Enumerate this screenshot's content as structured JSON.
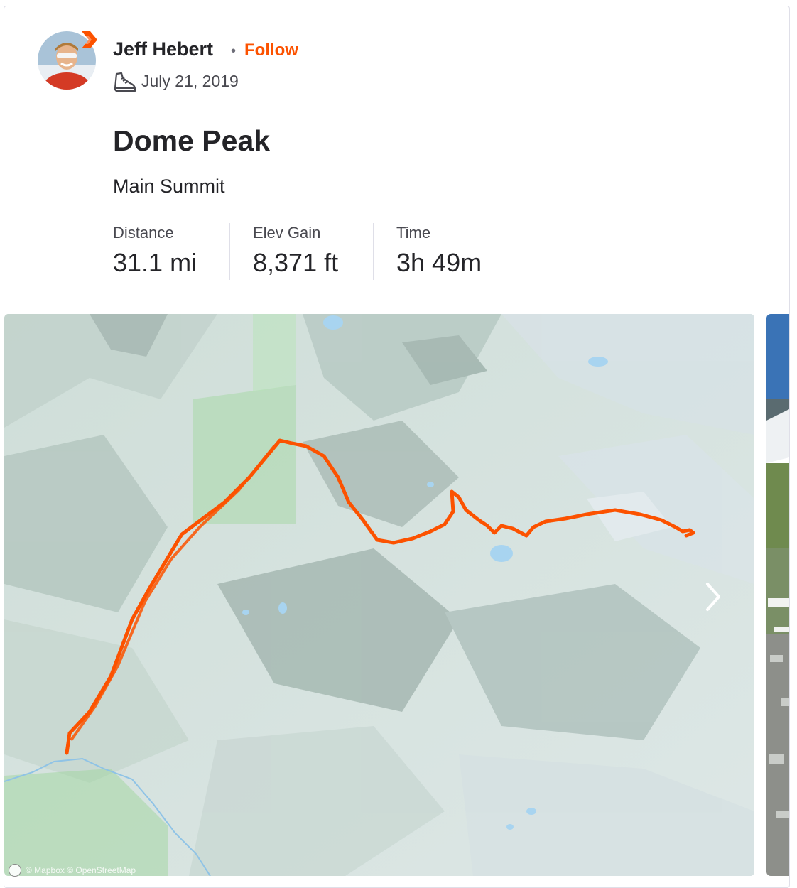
{
  "athlete": {
    "name": "Jeff Hebert",
    "separator": "•",
    "follow_label": "Follow",
    "avatar_icon": "athlete-avatar",
    "badge_icon": "subscriber-badge-icon"
  },
  "activity": {
    "date": "July 21, 2019",
    "sport_icon": "hiking-shoe-icon",
    "title": "Dome Peak",
    "description": "Main Summit"
  },
  "stats": [
    {
      "label": "Distance",
      "value": "31.1 mi"
    },
    {
      "label": "Elev Gain",
      "value": "8,371 ft"
    },
    {
      "label": "Time",
      "value": "3h 49m"
    }
  ],
  "map": {
    "route_color": "#fc5200",
    "attribution": "© Mapbox © OpenStreetMap",
    "next_icon": "chevron-right-icon"
  },
  "colors": {
    "accent": "#fc5200",
    "text": "#242428",
    "muted": "#494950"
  }
}
